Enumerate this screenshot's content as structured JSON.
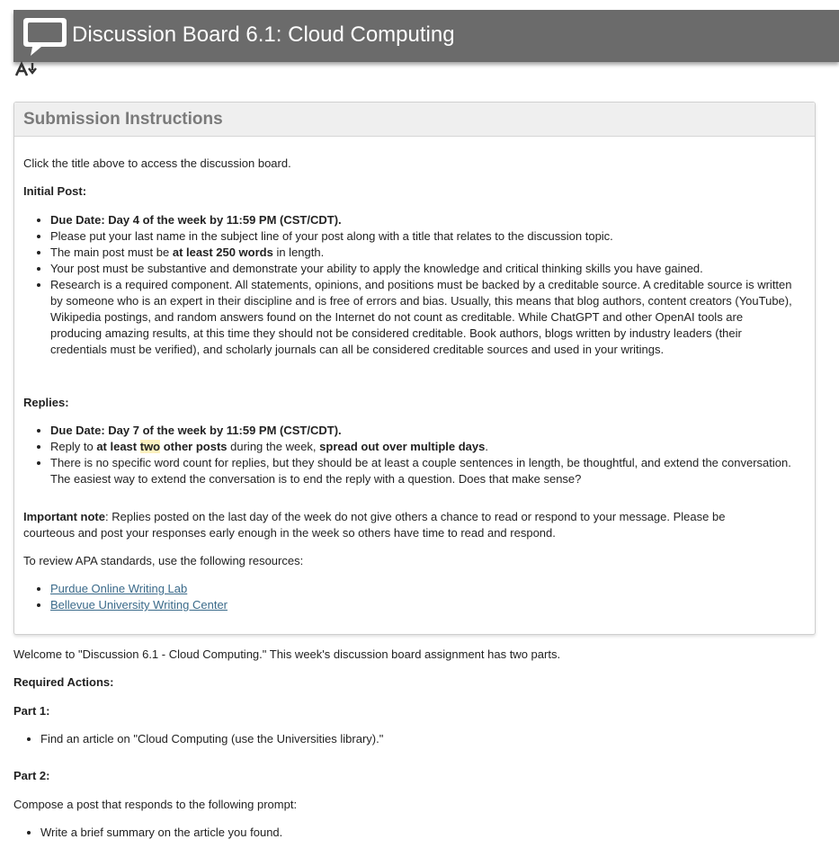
{
  "header": {
    "title": "Discussion Board 6.1: Cloud Computing",
    "icon": "speech-bubble-icon",
    "color": "#6b6b6b"
  },
  "font_tool": {
    "icon": "font-size-adjust-icon"
  },
  "instructions": {
    "heading": "Submission Instructions",
    "intro": "Click the title above to access the discussion board.",
    "initial_heading": "Initial Post:",
    "initial": {
      "due": "Due Date: Day 4 of the week by 11:59 PM (CST/CDT).",
      "name": "Please put your last name in the subject line of your post along with a title that relates to the discussion topic.",
      "words_pre": "The main post must be ",
      "words_bold": "at least 250 words",
      "words_post": " in length.",
      "substantive": "Your post must be substantive and demonstrate your ability to apply the knowledge and critical thinking skills you have gained.",
      "research": "Research is a required component.  All statements, opinions, and positions must be backed by a creditable source.  A creditable source is written by someone who is an expert in their discipline and is free of errors and bias.  Usually, this means that blog authors, content creators (YouTube), Wikipedia postings, and random answers found on the Internet do not count as creditable.  While ChatGPT and other OpenAI tools are producing amazing results, at this time they should not be considered creditable.  Book authors, blogs written by industry leaders (their credentials must be verified), and scholarly journals can all be considered creditable sources and used in your writings."
    },
    "replies_heading": "Replies:",
    "replies": {
      "due": "Due Date: Day 7 of the week by 11:59 PM (CST/CDT).",
      "reply_pre": "Reply to ",
      "reply_bold1": "at least ",
      "reply_hl": "two",
      "reply_bold2": " other posts",
      "reply_mid": " during the week, ",
      "reply_bold3": "spread out over multiple days",
      "reply_end": ".",
      "wordcount": "There is no specific word count for replies, but they should be at least a couple sentences in length, be thoughtful, and extend the conversation.  The easiest way to extend the conversation is to end the reply with a question.  Does that make sense?"
    },
    "note_label": "Important note",
    "note_line1": ": Replies posted on the last day of the week do not give others a chance to read or respond to your message.  Please be",
    "note_line2": "courteous and post your responses early enough in the week so others have time to read and respond.",
    "apa": "To review APA standards, use the following resources:",
    "links": [
      "Purdue Online Writing Lab",
      "Bellevue University Writing Center"
    ]
  },
  "body": {
    "welcome": "Welcome to \"Discussion 6.1 - Cloud Computing.\"  This week's discussion board assignment has two parts.",
    "required": "Required Actions:",
    "part1": "Part 1:",
    "part1_item": "Find an article on \"Cloud Computing (use the Universities library).\"",
    "part2": "Part 2:",
    "compose": "Compose a post that responds to the following prompt:",
    "part2_item": "Write a brief summary on the article you found."
  }
}
